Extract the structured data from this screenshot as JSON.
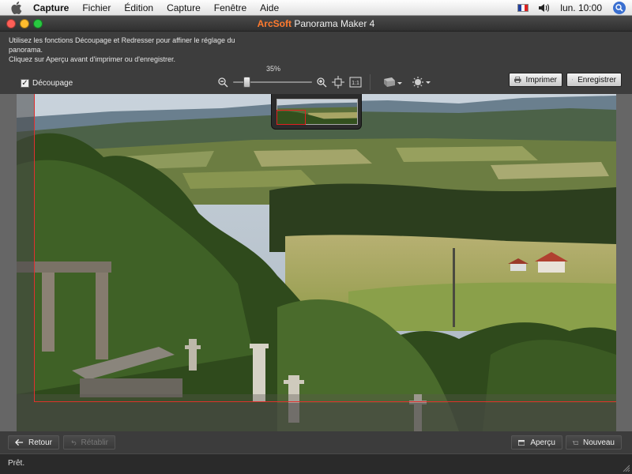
{
  "menubar": {
    "items": [
      "Capture",
      "Fichier",
      "Édition",
      "Capture",
      "Fenêtre",
      "Aide"
    ],
    "clock": "lun. 10:00"
  },
  "window": {
    "title_brand": "ArcSoft",
    "title_rest": "Panorama Maker 4"
  },
  "toolbar": {
    "instruction_line1": "Utilisez les fonctions Découpage et Redresser pour affiner le réglage du panorama.",
    "instruction_line2": "Cliquez sur Aperçu avant d'imprimer ou d'enregistrer.",
    "crop_label": "Découpage",
    "crop_checked": true,
    "zoom_percent_label": "35%",
    "zoom_level": 0.17,
    "print_label": "Imprimer",
    "save_label": "Enregistrer"
  },
  "bottombar": {
    "back_label": "Retour",
    "restore_label": "Rétablir",
    "preview_label": "Aperçu",
    "new_label": "Nouveau"
  },
  "status": {
    "text": "Prêt."
  },
  "colors": {
    "crop_line": "#e03030",
    "brand_orange": "#ff7a2e",
    "close": "#ff5f57",
    "minimize": "#febc2e",
    "zoom": "#28c840"
  },
  "icons": [
    "apple-icon",
    "flag-fr-icon",
    "volume-icon",
    "spotlight-icon",
    "zoom-out-icon",
    "zoom-in-icon",
    "fit-to-window-icon",
    "actual-size-icon",
    "print-settings-icon",
    "brightness-icon",
    "printer-icon",
    "floppy-disk-icon",
    "arrow-left-icon",
    "undo-icon",
    "preview-icon",
    "new-project-icon"
  ]
}
